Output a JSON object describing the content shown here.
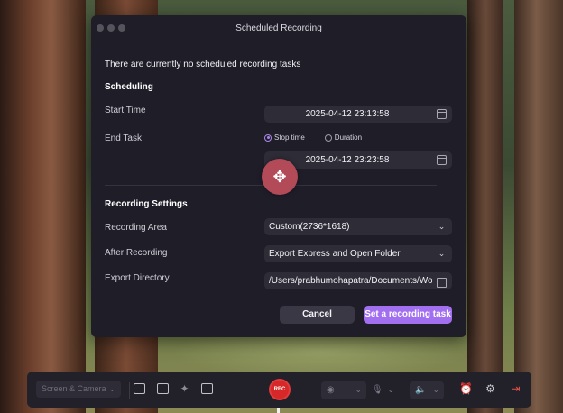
{
  "dialog": {
    "title": "Scheduled Recording",
    "notice": "There are currently no scheduled recording tasks",
    "scheduling": {
      "heading": "Scheduling",
      "start_label": "Start Time",
      "start_value": "2025-04-12 23:13:58",
      "end_label": "End Task",
      "options": [
        "Stop time",
        "Duration"
      ],
      "selected_option": "Stop time",
      "end_value": "2025-04-12 23:23:58"
    },
    "recording": {
      "heading": "Recording Settings",
      "area_label": "Recording Area",
      "area_value": "Custom(2736*1618)",
      "after_label": "After Recording",
      "after_value": "Export Express and Open Folder",
      "dir_label": "Export Directory",
      "dir_value": "/Users/prabhumohapatra/Documents/Won"
    },
    "cancel_label": "Cancel",
    "set_label": "Set a recording task"
  },
  "toolbar": {
    "mode_value": "Screen & Camera",
    "rec_label": "REC"
  },
  "colors": {
    "accent": "#a26ff0",
    "rec": "#d62828",
    "dialog_bg": "#1f1d28"
  }
}
